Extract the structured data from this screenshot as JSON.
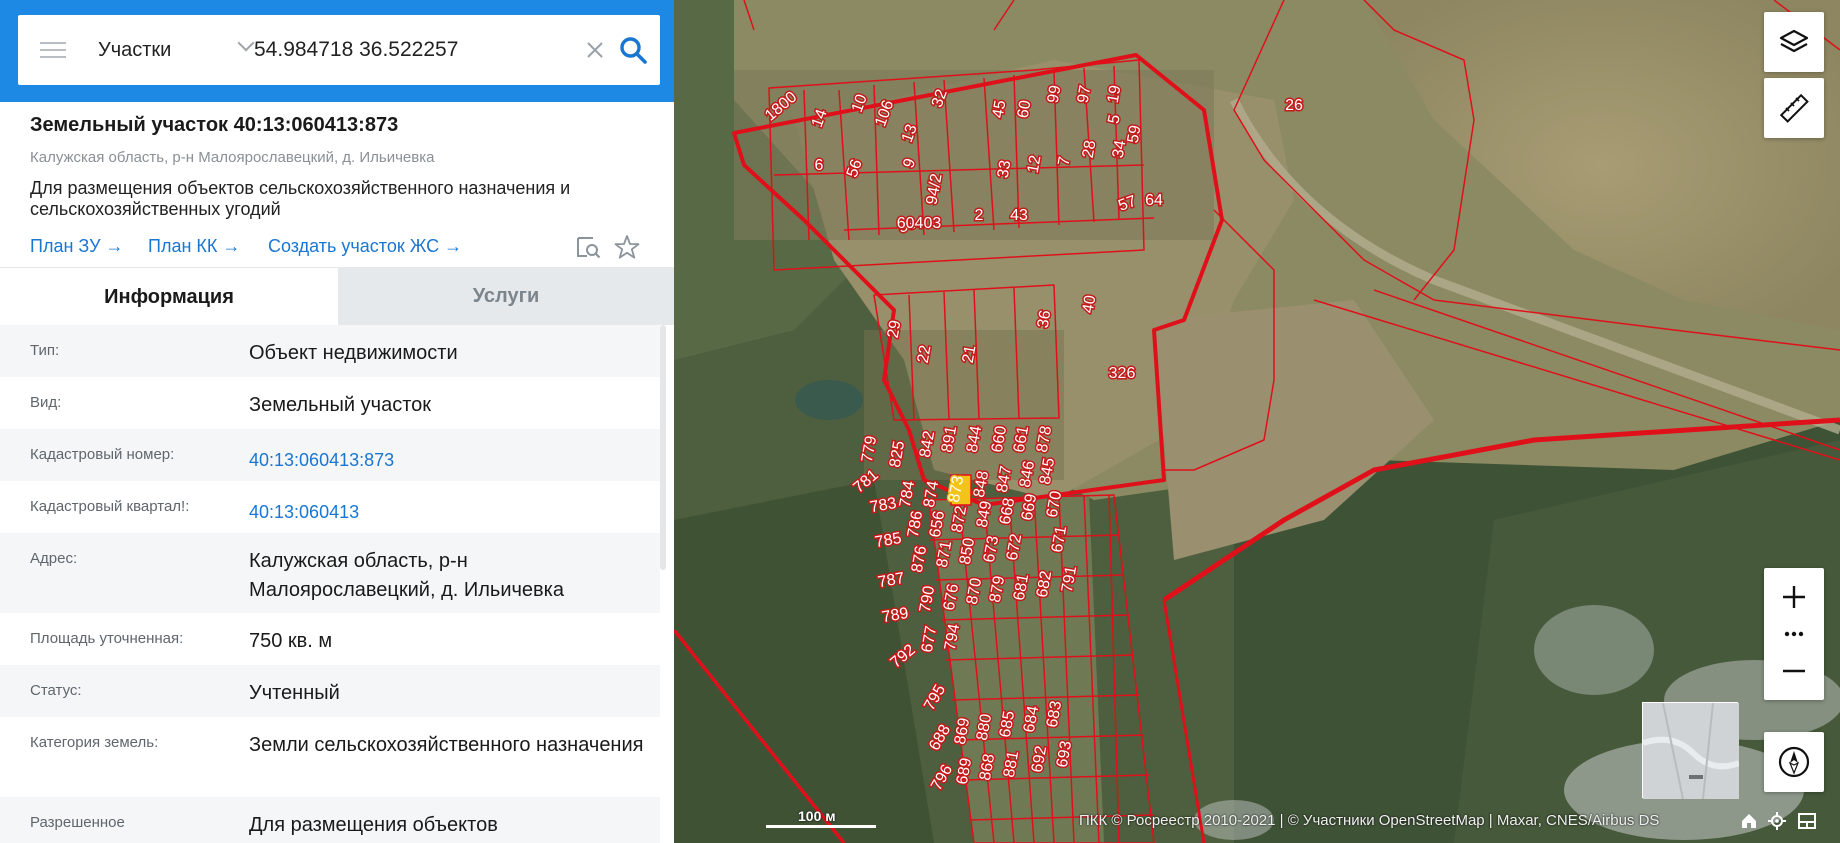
{
  "search": {
    "layer_label": "Участки",
    "query": "54.984718 36.522257"
  },
  "object": {
    "title": "Земельный участок 40:13:060413:873",
    "address": "Калужская область, р-н Малоярославецкий, д. Ильичевка",
    "description": "Для размещения объектов сельскохозяйственного назначения и сельскохозяйственных угодий"
  },
  "links": {
    "plan_zu": "План ЗУ",
    "plan_kk": "План КК",
    "create": "Создать участок ЖС",
    "arrow": "→"
  },
  "tabs": {
    "info": "Информация",
    "services": "Услуги"
  },
  "info_rows": [
    {
      "label": "Тип:",
      "value": "Объект недвижимости"
    },
    {
      "label": "Вид:",
      "value": "Земельный участок"
    },
    {
      "label": "Кадастровый номер:",
      "value": "40:13:060413:873"
    },
    {
      "label": "Кадастровый квартал!:",
      "value": "40:13:060413"
    },
    {
      "label": "Адрес:",
      "value": "Калужская область, р-н Малоярославецкий, д. Ильичевка"
    },
    {
      "label": "Площадь уточненная:",
      "value": "750 кв. м"
    },
    {
      "label": "Статус:",
      "value": "Учтенный"
    },
    {
      "label": "Категория земель:",
      "value": "Земли сельскохозяйственного назначения"
    },
    {
      "label": "Разрешенное",
      "value": "Для размещения объектов"
    }
  ],
  "map": {
    "scale_label": "100 м",
    "attribution": "ПКК © Росреестр 2010-2021 | © Участники OpenStreetMap | Maxar, CNES/Airbus DS",
    "block_label": "60403",
    "parcel_labels": [
      "1800",
      "14",
      "10",
      "106",
      "13",
      "32",
      "9",
      "56",
      "6",
      "94/2",
      "45",
      "60",
      "99",
      "97",
      "19",
      "5",
      "59",
      "33",
      "12",
      "7",
      "28",
      "34",
      "53",
      "2",
      "43",
      "57",
      "64",
      "26",
      "29",
      "22",
      "21",
      "36",
      "40",
      "326",
      "779",
      "825",
      "842",
      "891",
      "844",
      "660",
      "661",
      "878",
      "781",
      "784",
      "874",
      "873",
      "848",
      "847",
      "846",
      "845",
      "783",
      "786",
      "656",
      "872",
      "849",
      "668",
      "669",
      "670",
      "785",
      "671",
      "787",
      "876",
      "871",
      "850",
      "673",
      "672",
      "789",
      "790",
      "676",
      "870",
      "879",
      "681",
      "682",
      "791",
      "792",
      "677",
      "794",
      "795",
      "688",
      "869",
      "880",
      "685",
      "684",
      "683",
      "796",
      "689",
      "868",
      "881",
      "692",
      "693"
    ],
    "highlight_parcel": "873",
    "colors": {
      "boundary": "#E0101B",
      "highlight": "#F2C318",
      "accent": "#1E88E5"
    }
  }
}
